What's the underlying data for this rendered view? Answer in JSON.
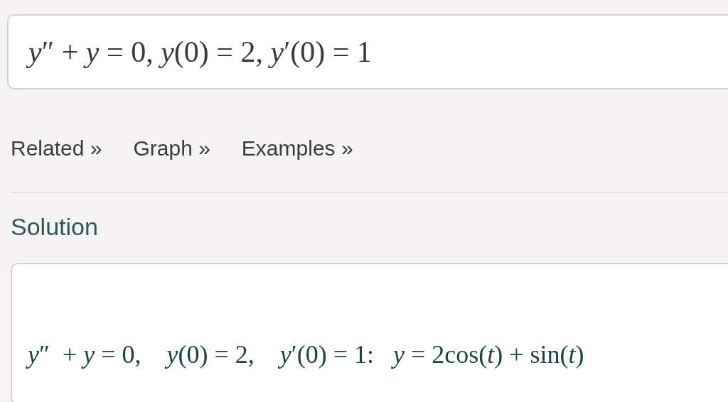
{
  "input": {
    "value": "*y*″ + *y* = 0, *y*(0) = 2, *y*′(0) = 1"
  },
  "links": [
    "Related »",
    "Graph »",
    "Examples »"
  ],
  "solution": {
    "heading": "Solution",
    "text": "*y*″  + *y* = 0,    *y*(0) = 2,    *y*′(0) = 1:   *y* = 2cos(*t*) + sin(*t*)"
  }
}
